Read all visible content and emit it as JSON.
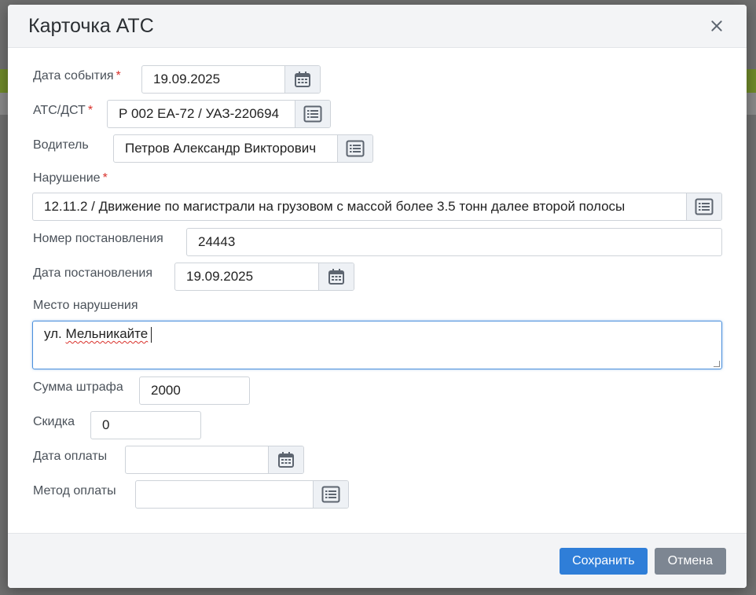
{
  "dialog": {
    "title": "Карточка АТС",
    "close_label": "×"
  },
  "form": {
    "event_date": {
      "label": "Дата события",
      "required": "*",
      "value": "19.09.2025"
    },
    "vehicle": {
      "label": "АТС/ДСТ",
      "required": "*",
      "value": "Р 002 ЕА-72 / УАЗ-220694"
    },
    "driver": {
      "label": "Водитель",
      "value": "Петров Александр Викторович"
    },
    "violation": {
      "label": "Нарушение",
      "required": "*",
      "value": "12.11.2 / Движение по магистрали на грузовом с массой более 3.5 тонн далее второй полосы"
    },
    "resolution_number": {
      "label": "Номер постановления",
      "value": "24443"
    },
    "resolution_date": {
      "label": "Дата постановления",
      "value": "19.09.2025"
    },
    "violation_place": {
      "label": "Место нарушения",
      "value_prefix": "ул.",
      "value_word": "Мельникайте"
    },
    "fine_amount": {
      "label": "Сумма штрафа",
      "value": "2000"
    },
    "discount": {
      "label": "Скидка",
      "value": "0"
    },
    "payment_date": {
      "label": "Дата оплаты",
      "value": ""
    },
    "payment_method": {
      "label": "Метод оплаты",
      "value": ""
    }
  },
  "footer": {
    "save_label": "Сохранить",
    "cancel_label": "Отмена"
  },
  "colors": {
    "primary": "#2f7ed8",
    "secondary": "#7d8692",
    "required": "#d9312b"
  }
}
